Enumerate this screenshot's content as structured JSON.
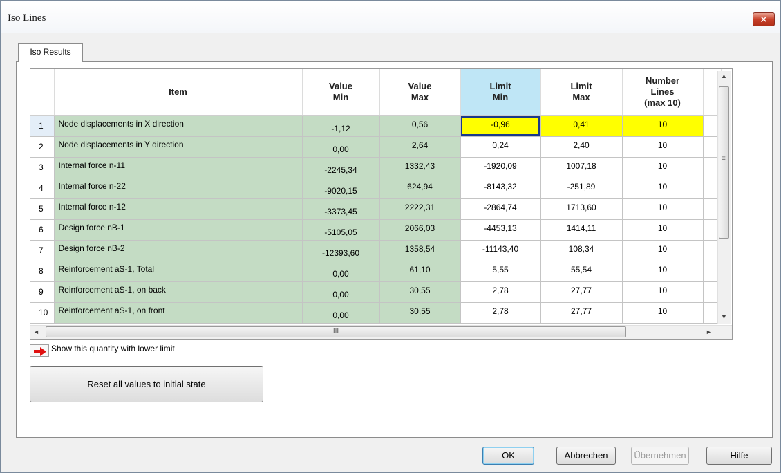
{
  "window": {
    "title": "Iso Lines",
    "close_glyph": "✕"
  },
  "tab": {
    "label": "Iso Results"
  },
  "grid": {
    "headers": {
      "item": "Item",
      "value_min": [
        "Value",
        "Min"
      ],
      "value_max": [
        "Value",
        "Max"
      ],
      "limit_min": [
        "Limit",
        "Min"
      ],
      "limit_max": [
        "Limit",
        "Max"
      ],
      "lines": [
        "Number",
        "Lines",
        "(max 10)"
      ]
    },
    "rows": [
      {
        "n": "1",
        "item": "Node displacements in X direction",
        "vmin": "-1,12",
        "vmax": "0,56",
        "lmin": "-0,96",
        "lmax": "0,41",
        "lines": "10"
      },
      {
        "n": "2",
        "item": "Node displacements in Y direction",
        "vmin": "0,00",
        "vmax": "2,64",
        "lmin": "0,24",
        "lmax": "2,40",
        "lines": "10"
      },
      {
        "n": "3",
        "item": "Internal force n-11",
        "vmin": "-2245,34",
        "vmax": "1332,43",
        "lmin": "-1920,09",
        "lmax": "1007,18",
        "lines": "10"
      },
      {
        "n": "4",
        "item": "Internal force n-22",
        "vmin": "-9020,15",
        "vmax": "624,94",
        "lmin": "-8143,32",
        "lmax": "-251,89",
        "lines": "10"
      },
      {
        "n": "5",
        "item": "Internal force n-12",
        "vmin": "-3373,45",
        "vmax": "2222,31",
        "lmin": "-2864,74",
        "lmax": "1713,60",
        "lines": "10"
      },
      {
        "n": "6",
        "item": "Design force nB-1",
        "vmin": "-5105,05",
        "vmax": "2066,03",
        "lmin": "-4453,13",
        "lmax": "1414,11",
        "lines": "10"
      },
      {
        "n": "7",
        "item": "Design force nB-2",
        "vmin": "-12393,60",
        "vmax": "1358,54",
        "lmin": "-11143,40",
        "lmax": "108,34",
        "lines": "10"
      },
      {
        "n": "8",
        "item": "Reinforcement aS-1, Total",
        "vmin": "0,00",
        "vmax": "61,10",
        "lmin": "5,55",
        "lmax": "55,54",
        "lines": "10"
      },
      {
        "n": "9",
        "item": "Reinforcement aS-1, on back",
        "vmin": "0,00",
        "vmax": "30,55",
        "lmin": "2,78",
        "lmax": "27,77",
        "lines": "10"
      },
      {
        "n": "10",
        "item": "Reinforcement aS-1, on front",
        "vmin": "0,00",
        "vmax": "30,55",
        "lmin": "2,78",
        "lmax": "27,77",
        "lines": "10"
      }
    ],
    "scroll": {
      "up": "▲",
      "down": "▼",
      "left": "◄",
      "right": "►",
      "hthumb_grip": "III",
      "vthumb_grip": "≡"
    }
  },
  "legend": {
    "text": "Show this quantity with lower limit",
    "arrow_color": "#e01010"
  },
  "buttons": {
    "reset": "Reset all values to initial state",
    "ok": "OK",
    "cancel": "Abbrechen",
    "apply": "Übernehmen",
    "help": "Hilfe"
  },
  "colors": {
    "highlight_yellow": "#ffff00",
    "readonly_green": "#c4dcc4",
    "selected_header": "#bfe6f6"
  }
}
